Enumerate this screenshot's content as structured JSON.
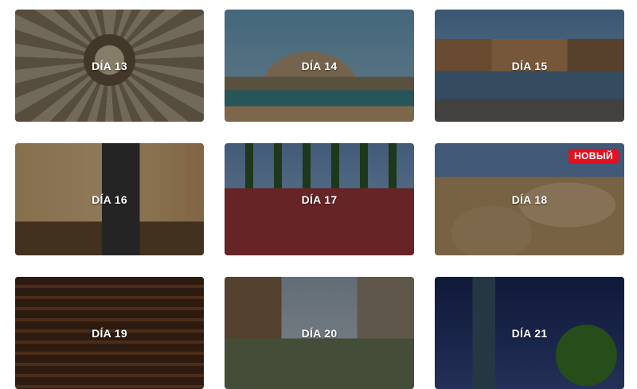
{
  "cards": [
    {
      "title": "DÍA 13",
      "badge": "",
      "scene": "s13"
    },
    {
      "title": "DÍA 14",
      "badge": "",
      "scene": "s14"
    },
    {
      "title": "DÍA 15",
      "badge": "",
      "scene": "s15"
    },
    {
      "title": "DÍA 16",
      "badge": "",
      "scene": "s16"
    },
    {
      "title": "DÍA 17",
      "badge": "",
      "scene": "s17"
    },
    {
      "title": "DÍA 18",
      "badge": "НОВЫЙ",
      "scene": "s18"
    },
    {
      "title": "DÍA 19",
      "badge": "",
      "scene": "s19"
    },
    {
      "title": "DÍA 20",
      "badge": "",
      "scene": "s20"
    },
    {
      "title": "DÍA 21",
      "badge": "",
      "scene": "s21"
    }
  ],
  "colors": {
    "badge": "#e3101f",
    "title_text": "#ffffff"
  }
}
